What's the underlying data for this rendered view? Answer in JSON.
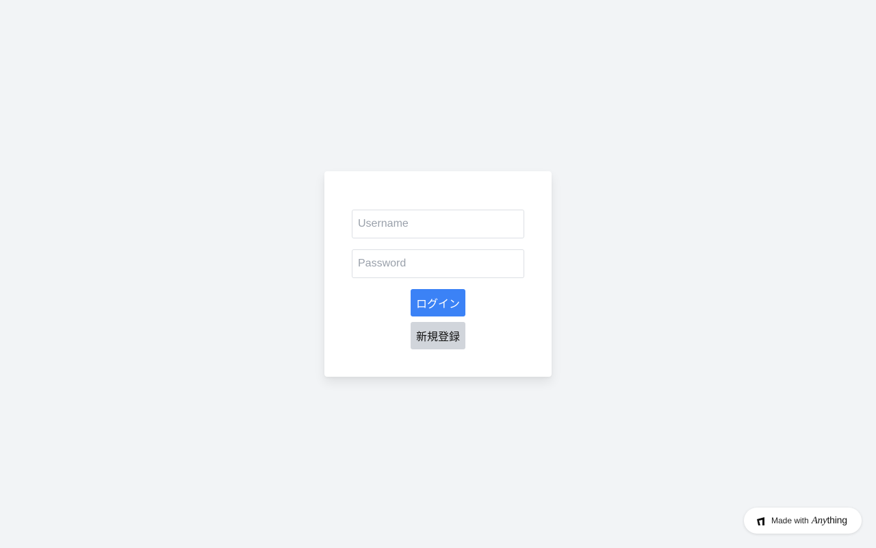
{
  "login_form": {
    "username_placeholder": "Username",
    "username_value": "",
    "password_placeholder": "Password",
    "password_value": "",
    "login_label": "ログイン",
    "register_label": "新規登録"
  },
  "badge": {
    "made_with_label": "Made with",
    "brand_italic": "Any",
    "brand_rest": "thing",
    "icon": "anything-logo-icon"
  },
  "colors": {
    "background": "#f2f4f6",
    "card": "#ffffff",
    "primary": "#3b82f6",
    "secondary": "#d1d5db"
  }
}
